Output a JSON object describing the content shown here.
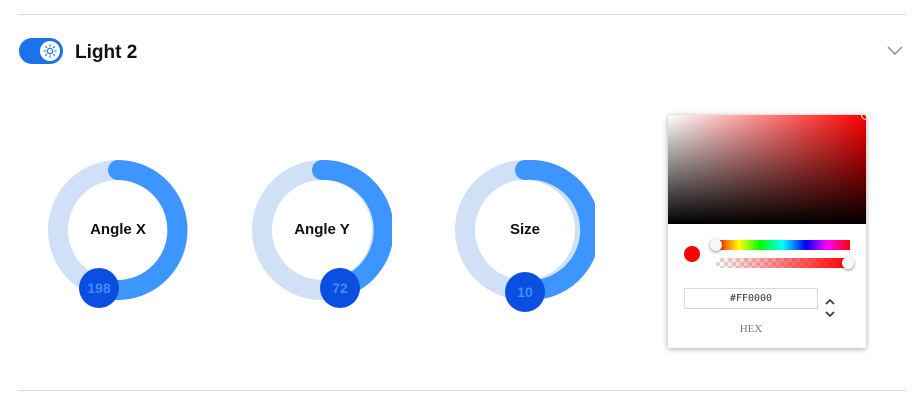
{
  "header": {
    "title": "Light 2",
    "toggle_on": true,
    "toggle_icon": "sun-icon",
    "collapse_icon": "chevron-down-icon",
    "accent_color": "#1a73e8"
  },
  "dials": [
    {
      "name": "angle-x",
      "label": "Angle X",
      "value": "198"
    },
    {
      "name": "angle-y",
      "label": "Angle Y",
      "value": "72"
    },
    {
      "name": "size",
      "label": "Size",
      "value": "10"
    }
  ],
  "dial_colors": {
    "track": "#cfe0f7",
    "progress": "#3d96ff",
    "handle": "#0a4fe0"
  },
  "color_picker": {
    "hex_value": "#FF0000",
    "mode_label": "HEX",
    "selected_color": "#ff0000",
    "hue_position": 0,
    "alpha": 1
  }
}
